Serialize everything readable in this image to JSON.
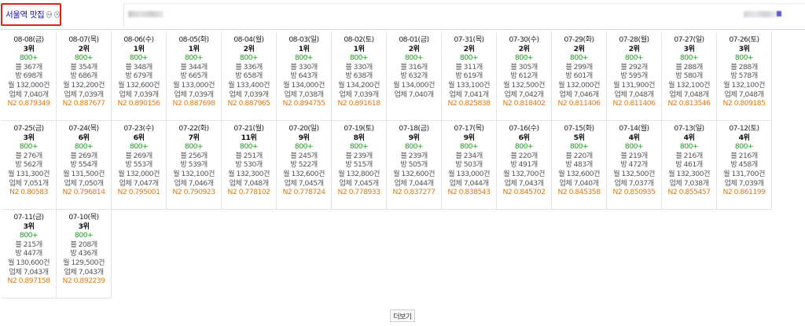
{
  "header": {
    "keyword": "서울역 맛집",
    "icon1": "↔",
    "icon2": "×"
  },
  "entries": [
    {
      "date": "08-08(금)",
      "rank": "3위",
      "count": "800+",
      "blog": "블 367개",
      "cafe": "방 698개",
      "monthly": "월 132,000건",
      "company": "업체 7,040개",
      "n2": "N2 0.879349"
    },
    {
      "date": "08-07(목)",
      "rank": "2위",
      "count": "800+",
      "blog": "블 354개",
      "cafe": "방 686개",
      "monthly": "월 132,200건",
      "company": "업체 7,039개",
      "n2": "N2 0.887677"
    },
    {
      "date": "08-06(수)",
      "rank": "1위",
      "count": "800+",
      "blog": "블 348개",
      "cafe": "방 679개",
      "monthly": "월 132,600건",
      "company": "업체 7,039개",
      "n2": "N2 0.890156"
    },
    {
      "date": "08-05(화)",
      "rank": "1위",
      "count": "800+",
      "blog": "블 344개",
      "cafe": "방 665개",
      "monthly": "월 133,000건",
      "company": "업체 7,039개",
      "n2": "N2 0.887698"
    },
    {
      "date": "08-04(월)",
      "rank": "2위",
      "count": "800+",
      "blog": "블 336개",
      "cafe": "방 658개",
      "monthly": "월 133,400건",
      "company": "업체 7,039개",
      "n2": "N2 0.887965"
    },
    {
      "date": "08-03(일)",
      "rank": "1위",
      "count": "800+",
      "blog": "블 330개",
      "cafe": "방 643개",
      "monthly": "월 134,000건",
      "company": "업체 7,038개",
      "n2": "N2 0.894755"
    },
    {
      "date": "08-02(토)",
      "rank": "1위",
      "count": "800+",
      "blog": "블 330개",
      "cafe": "방 638개",
      "monthly": "월 134,200건",
      "company": "업체 7,039개",
      "n2": "N2 0.891618"
    },
    {
      "date": "08-01(금)",
      "rank": "2위",
      "count": "800+",
      "blog": "블 316개",
      "cafe": "방 632개",
      "monthly": "월 134,000건",
      "company": "업체 7,040개",
      "n2": ""
    },
    {
      "date": "07-31(목)",
      "rank": "2위",
      "count": "800+",
      "blog": "블 311개",
      "cafe": "방 619개",
      "monthly": "월 133,100건",
      "company": "업체 7,041개",
      "n2": "N2 0.825838"
    },
    {
      "date": "07-30(수)",
      "rank": "2위",
      "count": "800+",
      "blog": "블 305개",
      "cafe": "방 612개",
      "monthly": "월 132,500건",
      "company": "업체 7,042개",
      "n2": "N2 0.818402"
    },
    {
      "date": "07-29(화)",
      "rank": "2위",
      "count": "800+",
      "blog": "블 299개",
      "cafe": "방 601개",
      "monthly": "월 132,000건",
      "company": "업체 7,046개",
      "n2": "N2 0.811406"
    },
    {
      "date": "07-28(월)",
      "rank": "2위",
      "count": "800+",
      "blog": "블 292개",
      "cafe": "방 595개",
      "monthly": "월 131,900건",
      "company": "업체 7,048개",
      "n2": "N2 0.811406"
    },
    {
      "date": "07-27(일)",
      "rank": "3위",
      "count": "800+",
      "blog": "블 288개",
      "cafe": "방 580개",
      "monthly": "월 132,100건",
      "company": "업체 7,048개",
      "n2": "N2 0.813546"
    },
    {
      "date": "07-26(토)",
      "rank": "3위",
      "count": "800+",
      "blog": "블 288개",
      "cafe": "방 578개",
      "monthly": "월 132,100건",
      "company": "업체 7,048개",
      "n2": "N2 0.809185"
    },
    {
      "date": "07-25(금)",
      "rank": "3위",
      "count": "800+",
      "blog": "블 276개",
      "cafe": "방 562개",
      "monthly": "월 131,300건",
      "company": "업체 7,051개",
      "n2": "N2 0.80583"
    },
    {
      "date": "07-24(목)",
      "rank": "6위",
      "count": "800+",
      "blog": "블 269개",
      "cafe": "방 554개",
      "monthly": "월 131,500건",
      "company": "업체 7,050개",
      "n2": "N2 0.796814"
    },
    {
      "date": "07-23(수)",
      "rank": "6위",
      "count": "800+",
      "blog": "블 269개",
      "cafe": "방 553개",
      "monthly": "월 132,000건",
      "company": "업체 7,047개",
      "n2": "N2 0.795001"
    },
    {
      "date": "07-22(화)",
      "rank": "7위",
      "count": "800+",
      "blog": "블 256개",
      "cafe": "방 539개",
      "monthly": "월 132,100건",
      "company": "업체 7,046개",
      "n2": "N2 0.790923"
    },
    {
      "date": "07-21(월)",
      "rank": "11위",
      "count": "800+",
      "blog": "블 251개",
      "cafe": "방 530개",
      "monthly": "월 132,300건",
      "company": "업체 7,048개",
      "n2": "N2 0.778102"
    },
    {
      "date": "07-20(일)",
      "rank": "9위",
      "count": "800+",
      "blog": "블 245개",
      "cafe": "방 522개",
      "monthly": "월 132,600건",
      "company": "업체 7,045개",
      "n2": "N2 0.778724"
    },
    {
      "date": "07-19(토)",
      "rank": "8위",
      "count": "800+",
      "blog": "블 239개",
      "cafe": "방 515개",
      "monthly": "월 132,800건",
      "company": "업체 7,045개",
      "n2": "N2 0.778933"
    },
    {
      "date": "07-18(금)",
      "rank": "9위",
      "count": "800+",
      "blog": "블 239개",
      "cafe": "방 505개",
      "monthly": "월 132,600건",
      "company": "업체 7,044개",
      "n2": "N2 0.837277"
    },
    {
      "date": "07-17(목)",
      "rank": "9위",
      "count": "800+",
      "blog": "블 234개",
      "cafe": "방 503개",
      "monthly": "월 133,000건",
      "company": "업체 7,044개",
      "n2": "N2 0.838543"
    },
    {
      "date": "07-16(수)",
      "rank": "6위",
      "count": "800+",
      "blog": "블 220개",
      "cafe": "방 491개",
      "monthly": "월 132,700건",
      "company": "업체 7,043개",
      "n2": "N2 0.845702"
    },
    {
      "date": "07-15(화)",
      "rank": "5위",
      "count": "800+",
      "blog": "블 220개",
      "cafe": "방 483개",
      "monthly": "월 132,600건",
      "company": "업체 7,040개",
      "n2": "N2 0.845358"
    },
    {
      "date": "07-14(월)",
      "rank": "4위",
      "count": "800+",
      "blog": "블 219개",
      "cafe": "방 472개",
      "monthly": "월 132,500건",
      "company": "업체 7,037개",
      "n2": "N2 0.850935"
    },
    {
      "date": "07-13(일)",
      "rank": "4위",
      "count": "800+",
      "blog": "블 216개",
      "cafe": "방 461개",
      "monthly": "월 132,300건",
      "company": "업체 7,038개",
      "n2": "N2 0.855457"
    },
    {
      "date": "07-12(토)",
      "rank": "4위",
      "count": "800+",
      "blog": "블 216개",
      "cafe": "방 458개",
      "monthly": "월 131,700건",
      "company": "업체 7,039개",
      "n2": "N2 0.861199"
    },
    {
      "date": "07-11(금)",
      "rank": "3위",
      "count": "800+",
      "blog": "블 215개",
      "cafe": "방 447개",
      "monthly": "월 130,600건",
      "company": "업체 7,043개",
      "n2": "N2 0.897158"
    },
    {
      "date": "07-10(목)",
      "rank": "3위",
      "count": "800+",
      "blog": "블 208개",
      "cafe": "방 436개",
      "monthly": "월 129,500건",
      "company": "업체 7,043개",
      "n2": "N2 0.892239"
    }
  ],
  "more_label": "더보기"
}
